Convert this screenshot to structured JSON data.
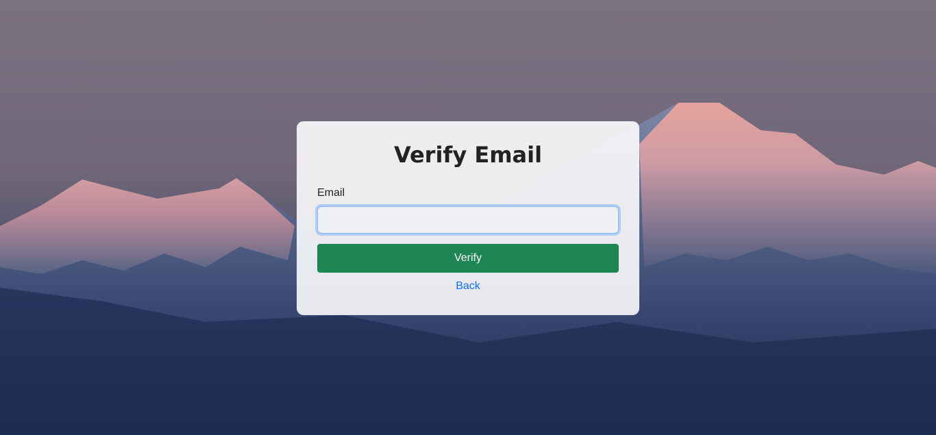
{
  "card": {
    "title": "Verify Email",
    "email_label": "Email",
    "email_value": "",
    "email_placeholder": "",
    "verify_label": "Verify",
    "back_label": "Back"
  },
  "colors": {
    "verify_button": "#1e8554",
    "link": "#0d6efd",
    "input_focus": "#86b7fe"
  }
}
